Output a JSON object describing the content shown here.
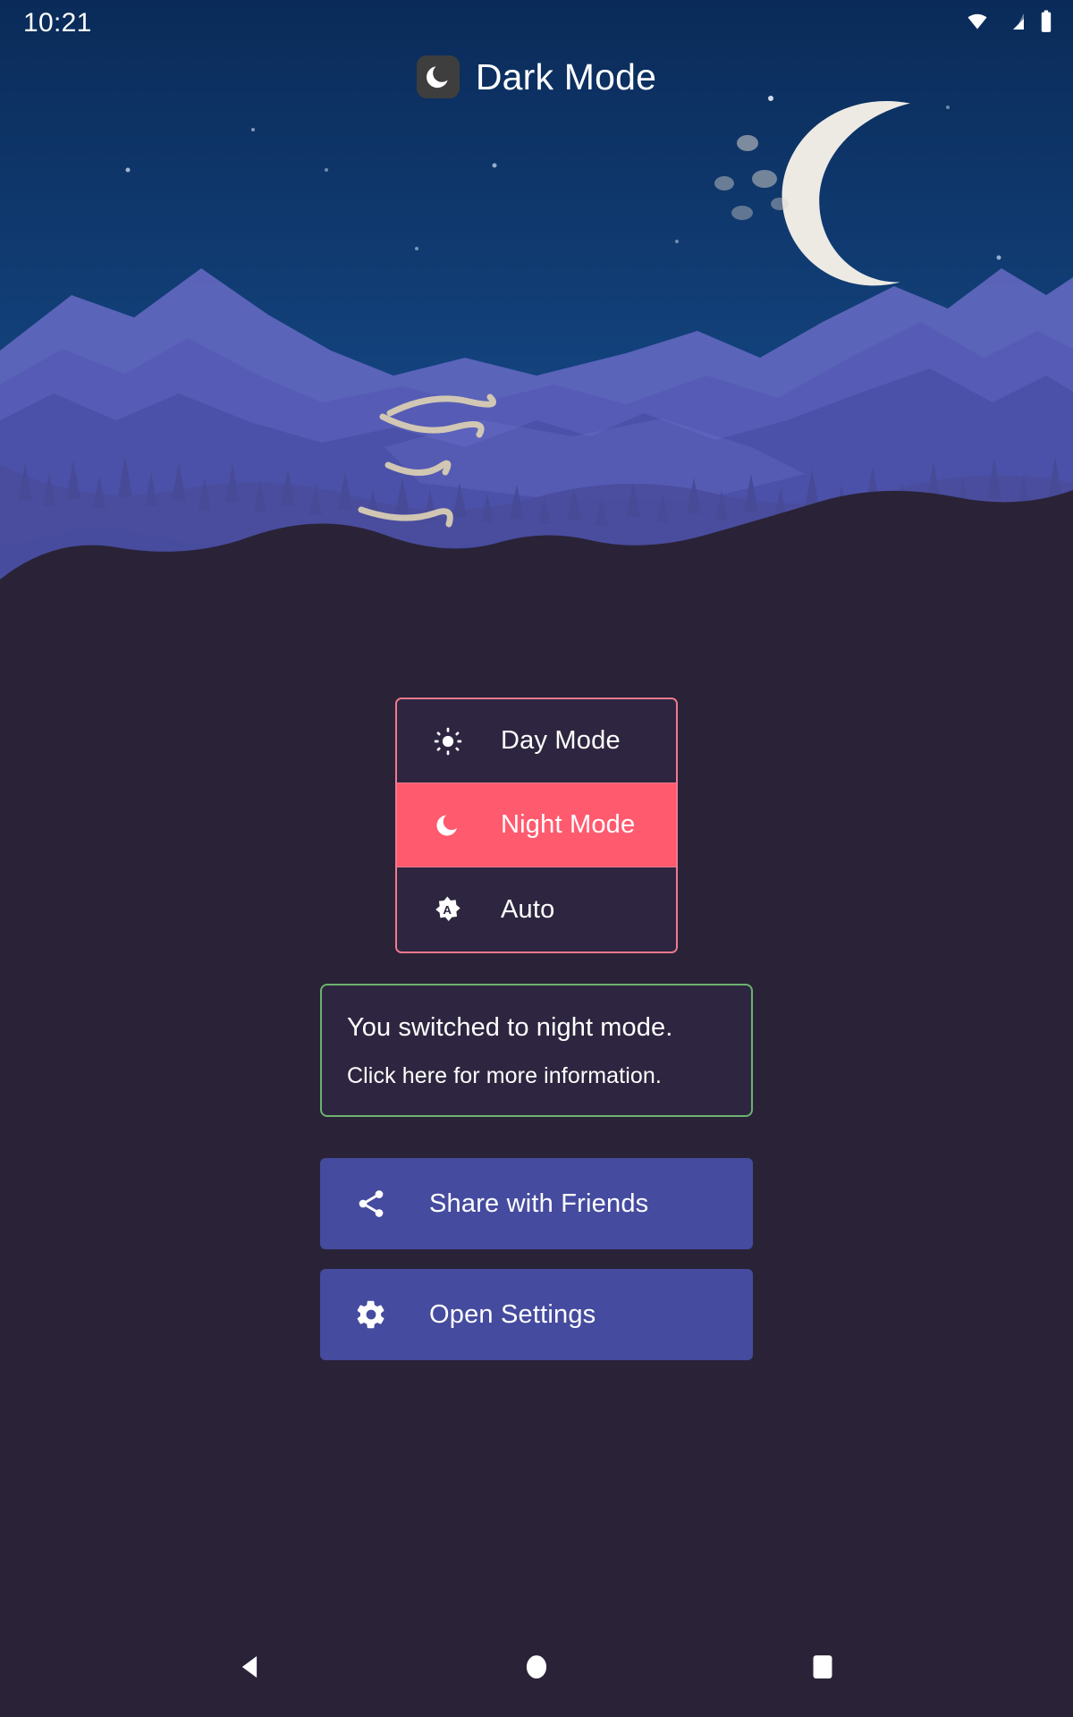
{
  "statusbar": {
    "time": "10:21",
    "icons": [
      "wifi-icon",
      "cellular-signal-icon",
      "battery-icon"
    ]
  },
  "appbar": {
    "title": "Dark Mode",
    "icon": "moon-icon",
    "icon_bg": "#3E3E3E"
  },
  "hero": {
    "name": "night-mountain-landscape",
    "sky_top": "#0A2B59",
    "sky_bottom": "#1D50A0",
    "moon_color": "#EDEAE4",
    "mountain_far": "#5B61B5",
    "mountain_mid": "#4A51A8",
    "forest": "#4B4E9A",
    "foreground": "#2A2338",
    "river_color": "#D8CDB4"
  },
  "mode_selector": {
    "border_color": "#F2798E",
    "active_bg": "#FF5A6E",
    "inactive_bg": "#2E2640",
    "options": [
      {
        "label": "Day Mode",
        "icon": "sun-icon",
        "selected": false
      },
      {
        "label": "Night Mode",
        "icon": "crescent-moon-icon",
        "selected": true
      },
      {
        "label": "Auto",
        "icon": "auto-brightness-icon",
        "selected": false
      }
    ]
  },
  "notice": {
    "border_color": "#6CB26F",
    "title": "You switched to night mode.",
    "subtitle": "Click here for more information."
  },
  "actions": {
    "button_color": "#454B9E",
    "items": [
      {
        "label": "Share with Friends",
        "icon": "share-icon"
      },
      {
        "label": "Open Settings",
        "icon": "gear-icon"
      }
    ]
  },
  "navbar": {
    "items": [
      {
        "name": "back-button",
        "icon": "triangle-back-icon"
      },
      {
        "name": "home-button",
        "icon": "circle-home-icon"
      },
      {
        "name": "recents-button",
        "icon": "square-recents-icon"
      }
    ]
  }
}
